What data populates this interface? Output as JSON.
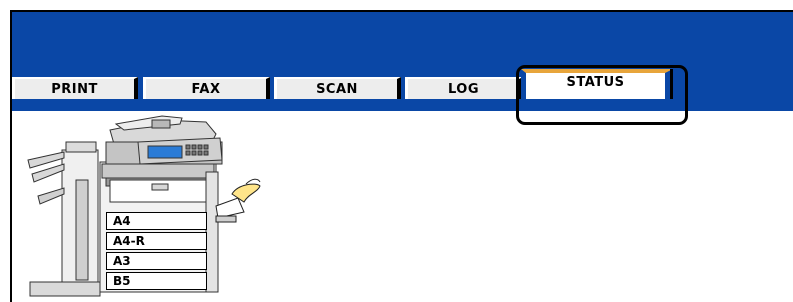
{
  "tabs": [
    {
      "id": "print",
      "label": "PRINT",
      "active": false
    },
    {
      "id": "fax",
      "label": "FAX",
      "active": false
    },
    {
      "id": "scan",
      "label": "SCAN",
      "active": false
    },
    {
      "id": "log",
      "label": "LOG",
      "active": false
    },
    {
      "id": "status",
      "label": "STATUS",
      "active": true
    }
  ],
  "trays": [
    {
      "label": "A4"
    },
    {
      "label": "A4-R"
    },
    {
      "label": "A3"
    },
    {
      "label": "B5"
    }
  ],
  "colors": {
    "header": "#0a47a6",
    "tab_bg": "#ededed",
    "active_accent": "#e8a53b"
  },
  "icons": {
    "device": "mfp-copier-icon",
    "exit_tray": "paper-output-hand-icon"
  }
}
